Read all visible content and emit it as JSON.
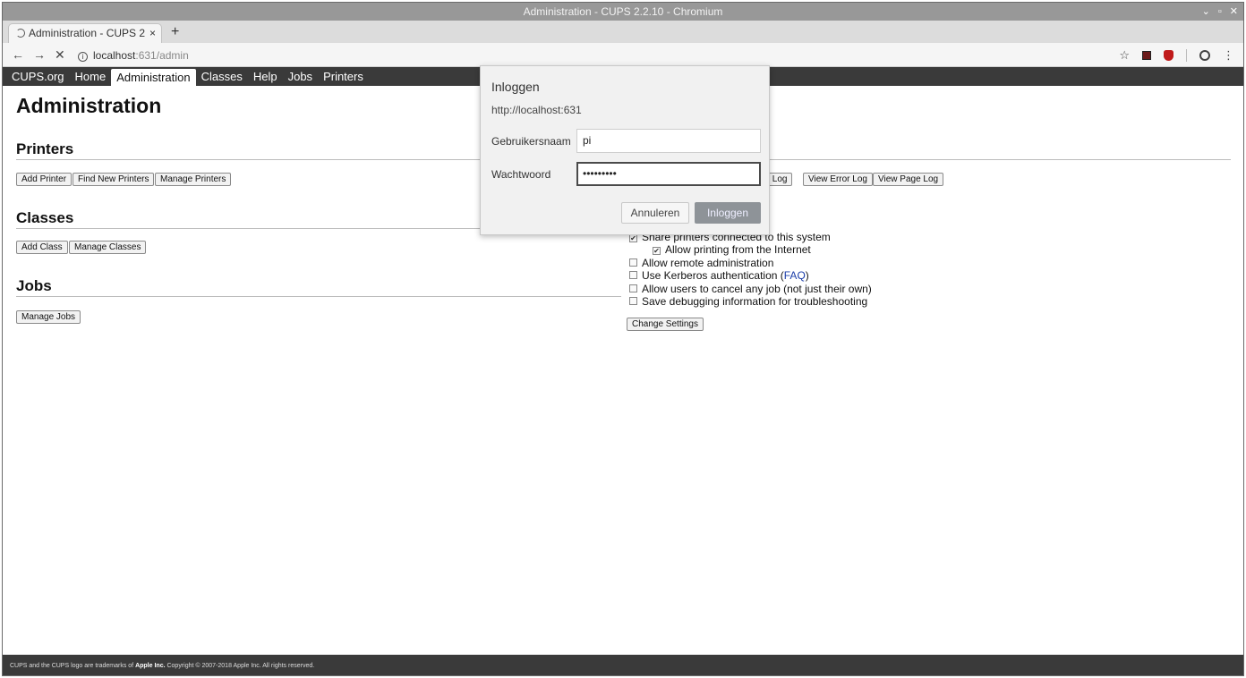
{
  "window": {
    "title": "Administration - CUPS 2.2.10 - Chromium",
    "controls": [
      "⌄",
      "▫",
      "✕"
    ]
  },
  "tab": {
    "title": "Administration - CUPS 2",
    "close": "×",
    "new_tab": "+"
  },
  "toolbar": {
    "back": "←",
    "forward": "→",
    "stop": "✕",
    "info": "i",
    "url_host": "localhost",
    "url_path": ":631/admin",
    "bookmark": "☆",
    "menu": "⋮"
  },
  "cups_nav": [
    "CUPS.org",
    "Home",
    "Administration",
    "Classes",
    "Help",
    "Jobs",
    "Printers"
  ],
  "page": {
    "title": "Administration",
    "printers": {
      "heading": "Printers",
      "buttons": [
        "Add Printer",
        "Find New Printers",
        "Manage Printers"
      ]
    },
    "classes": {
      "heading": "Classes",
      "buttons": [
        "Add Class",
        "Manage Classes"
      ]
    },
    "jobs": {
      "heading": "Jobs",
      "buttons": [
        "Manage Jobs"
      ]
    },
    "server": {
      "log_buttons": [
        "ss Log",
        "View Error Log",
        "View Page Log"
      ],
      "settings": [
        {
          "label": "Share printers connected to this system",
          "checked": true
        },
        {
          "label": "Allow printing from the Internet",
          "checked": true
        },
        {
          "label": "Allow remote administration",
          "checked": false
        },
        {
          "label": "Use Kerberos authentication (",
          "link": "FAQ",
          "suffix": ")",
          "checked": false
        },
        {
          "label": "Allow users to cancel any job (not just their own)",
          "checked": false
        },
        {
          "label": "Save debugging information for troubleshooting",
          "checked": false
        }
      ],
      "change_settings": "Change Settings"
    }
  },
  "footer": {
    "prefix": "CUPS and the CUPS logo are trademarks of ",
    "brand": "Apple Inc.",
    "suffix": " Copyright © 2007-2018 Apple Inc. All rights reserved."
  },
  "dialog": {
    "title": "Inloggen",
    "url": "http://localhost:631",
    "username_label": "Gebruikersnaam",
    "username_value": "pi",
    "password_label": "Wachtwoord",
    "password_value": "•••••••••",
    "cancel": "Annuleren",
    "submit": "Inloggen"
  }
}
